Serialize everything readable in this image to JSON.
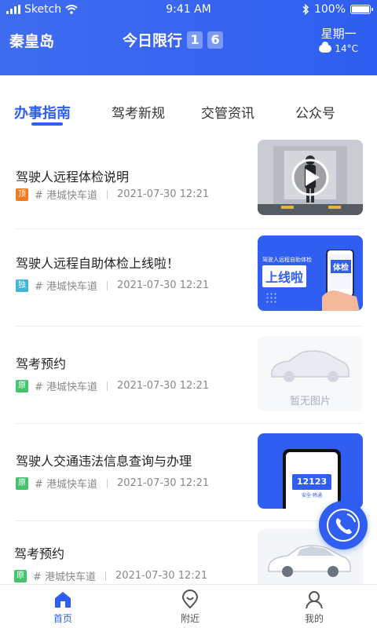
{
  "status_bar": {
    "carrier": "Sketch",
    "time": "9:41 AM",
    "battery": "100%"
  },
  "header": {
    "city": "秦皇岛",
    "limit_label": "今日限行",
    "limit_digits": [
      "1",
      "6"
    ],
    "weekday": "星期一",
    "temperature": "14°C",
    "weather_icon": "cloud-sun-icon"
  },
  "tabs": [
    "办事指南",
    "驾考新规",
    "交管资讯",
    "公众号"
  ],
  "active_tab": 0,
  "news": [
    {
      "title": "驾驶人远程体检说明",
      "tag": "顶",
      "tag_color": "#f07a1e",
      "channel": "# 港城快车道",
      "date": "2021-07-30 12:21",
      "thumb": "video-thumbnail"
    },
    {
      "title": "驾驶人远程自助体检上线啦！",
      "tag": "独",
      "tag_color": "#3fb6d8",
      "channel": "# 港城快车道",
      "date": "2021-07-30 12:21",
      "thumb": "promo-banner",
      "thumb_text": {
        "top": "驾驶人远程自助体检",
        "main": "上线啦",
        "badge": "体检"
      }
    },
    {
      "title": "驾考预约",
      "tag": "原",
      "tag_color": "#44c36e",
      "channel": "# 港城快车道",
      "date": "2021-07-30 12:21",
      "thumb": "no-image",
      "thumb_text": "暂无图片"
    },
    {
      "title": "驾驶人交通违法信息查询与办理",
      "tag": "原",
      "tag_color": "#44c36e",
      "channel": "# 港城快车道",
      "date": "2021-07-30 12:21",
      "thumb": "app-phone",
      "thumb_text": {
        "logo": "12123",
        "sub": "安全·畅通"
      }
    },
    {
      "title": "驾考预约",
      "tag": "原",
      "tag_color": "#44c36e",
      "channel": "# 港城快车道",
      "date": "2021-07-30 12:21",
      "thumb": "car-image"
    }
  ],
  "bottom_nav": [
    {
      "label": "首页",
      "icon": "home-icon"
    },
    {
      "label": "附近",
      "icon": "location-icon"
    },
    {
      "label": "我的",
      "icon": "user-icon"
    }
  ],
  "fab_icon": "phone-call-icon",
  "colors": {
    "primary": "#2f5ef0",
    "header_gradient_start": "#3f6cf0"
  }
}
